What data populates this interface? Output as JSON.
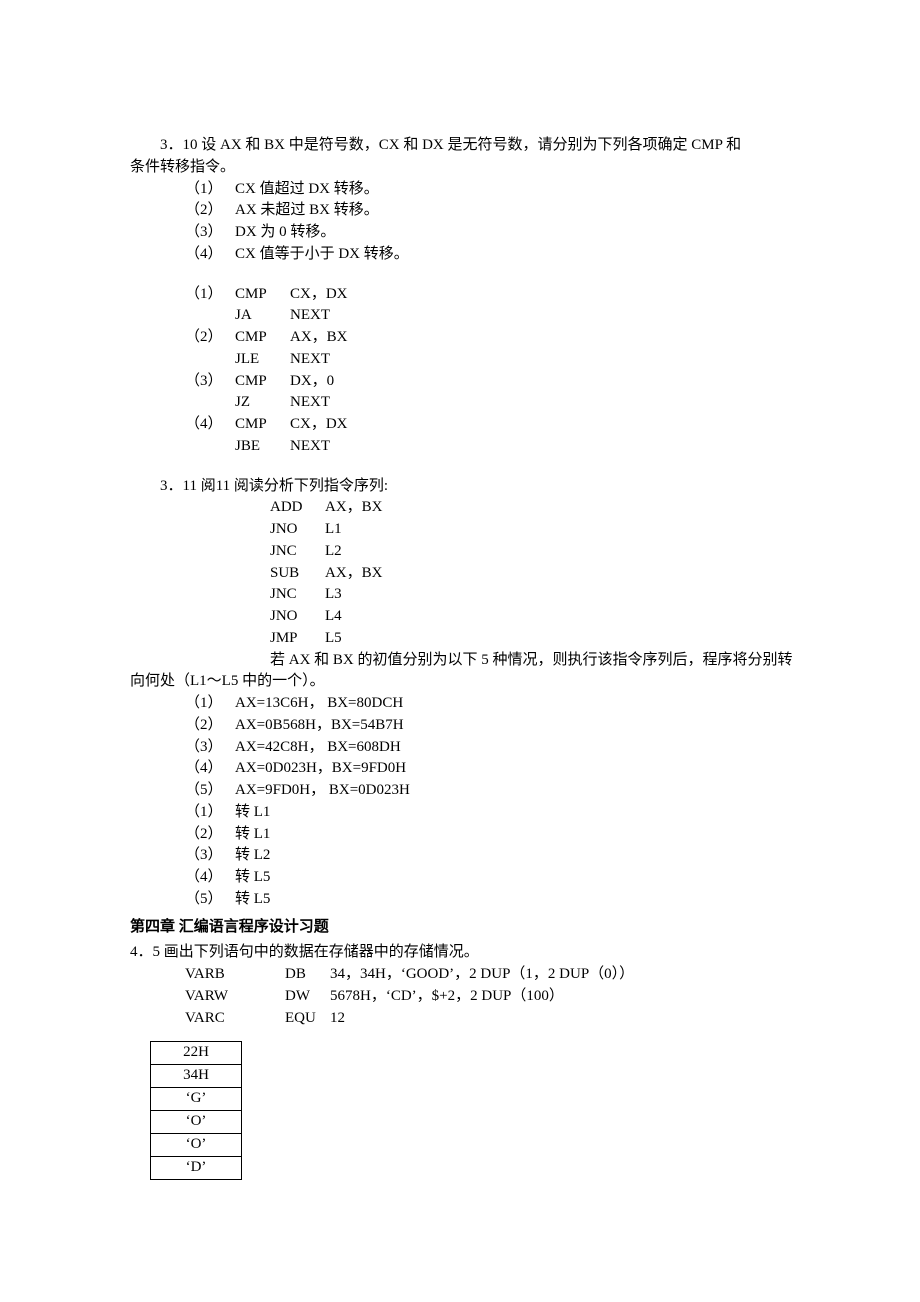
{
  "q310": {
    "prompt_a": "3．10  设 AX 和 BX 中是符号数，CX 和 DX 是无符号数，请分别为下列各项确定 CMP 和",
    "prompt_b": "条件转移指令。",
    "items": [
      {
        "n": "（1）",
        "t": "CX 值超过 DX 转移。"
      },
      {
        "n": "（2）",
        "t": "AX 未超过 BX 转移。"
      },
      {
        "n": "（3）",
        "t": "DX 为 0 转移。"
      },
      {
        "n": "（4）",
        "t": "CX 值等于小于 DX 转移。"
      }
    ],
    "answers": [
      {
        "n": "（1）",
        "l1op": "CMP",
        "l1arg": "CX，DX",
        "l2op": "JA",
        "l2arg": "NEXT"
      },
      {
        "n": "（2）",
        "l1op": "CMP",
        "l1arg": "AX，BX",
        "l2op": "JLE",
        "l2arg": "NEXT"
      },
      {
        "n": "（3）",
        "l1op": "CMP",
        "l1arg": "DX，0",
        "l2op": "JZ",
        "l2arg": "NEXT"
      },
      {
        "n": "（4）",
        "l1op": "CMP",
        "l1arg": "CX，DX",
        "l2op": "JBE",
        "l2arg": "NEXT"
      }
    ]
  },
  "q311": {
    "heading": "3．11  阅11 阅读分析下列指令序列:",
    "seq": [
      {
        "op": "ADD",
        "arg": "AX，BX"
      },
      {
        "op": "JNO",
        "arg": "L1"
      },
      {
        "op": "JNC",
        "arg": "L2"
      },
      {
        "op": "SUB",
        "arg": "AX，BX"
      },
      {
        "op": "JNC",
        "arg": "L3"
      },
      {
        "op": "JNO",
        "arg": "L4"
      },
      {
        "op": "JMP",
        "arg": "L5"
      }
    ],
    "mid_a": "若 AX 和 BX 的初值分别为以下 5 种情况，则执行该指令序列后，程序将分别转",
    "mid_b": "向何处（L1～L5 中的一个）。",
    "cases": [
      {
        "n": "（1）",
        "t": "AX=13C6H，  BX=80DCH"
      },
      {
        "n": "（2）",
        "t": "AX=0B568H，BX=54B7H"
      },
      {
        "n": "（3）",
        "t": "AX=42C8H，  BX=608DH"
      },
      {
        "n": "（4）",
        "t": "AX=0D023H，BX=9FD0H"
      },
      {
        "n": "（5）",
        "t": "AX=9FD0H，  BX=0D023H"
      }
    ],
    "results": [
      {
        "n": "（1）",
        "t": "转 L1"
      },
      {
        "n": "（2）",
        "t": "转 L1"
      },
      {
        "n": "（3）",
        "t": "转 L2"
      },
      {
        "n": "（4）",
        "t": "转 L5"
      },
      {
        "n": "（5）",
        "t": "转 L5"
      }
    ]
  },
  "chapter4": {
    "title": "第四章    汇编语言程序设计习题"
  },
  "q45": {
    "heading": "4．5  画出下列语句中的数据在存储器中的存储情况。",
    "decls": [
      {
        "v": "VARB",
        "d": "DB",
        "a": "34，34H，‘GOOD’，2 DUP（1，2 DUP（0））"
      },
      {
        "v": "VARW",
        "d": "DW",
        "a": "5678H，‘CD’，$+2，2 DUP（100）"
      },
      {
        "v": "VARC",
        "d": "EQU",
        "a": "12"
      }
    ],
    "mem": [
      "22H",
      "34H",
      "‘G’",
      "‘O’",
      "‘O’",
      "‘D’"
    ]
  }
}
